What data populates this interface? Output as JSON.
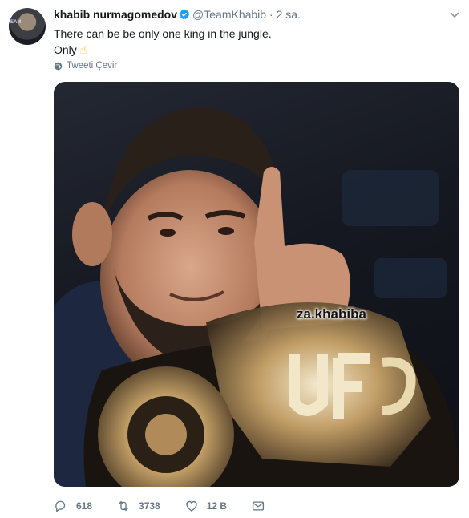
{
  "tweet": {
    "author": {
      "name": "khabib nurmagomedov",
      "handle": "@TeamKhabib",
      "time": "2 sa."
    },
    "avatar_text": "EAM",
    "lines": [
      "There can be be only one king in the jungle.",
      "Only"
    ],
    "emoji": "☝",
    "translate_label": "Tweeti Çevir",
    "media": {
      "watermark": "za.khabiba"
    },
    "stats": {
      "replies": "618",
      "retweets": "3738",
      "likes": "12 B"
    },
    "colors": {
      "verified": "#1da1f2",
      "muted": "#657786",
      "text": "#14171a"
    },
    "icons": [
      "verified-badge-icon",
      "chevron-down-icon",
      "globe-icon",
      "reply-icon",
      "retweet-icon",
      "like-icon",
      "dm-icon"
    ]
  }
}
